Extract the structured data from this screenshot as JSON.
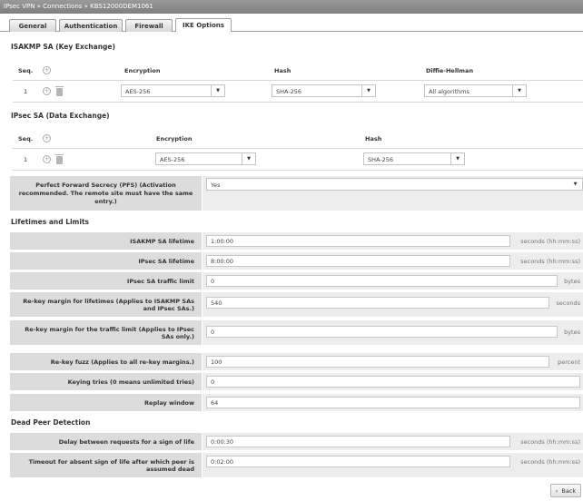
{
  "breadcrumb": "IPsec VPN » Connections » KBS12000DEM1061",
  "tabs": [
    {
      "label": "General"
    },
    {
      "label": "Authentication"
    },
    {
      "label": "Firewall"
    },
    {
      "label": "IKE Options"
    }
  ],
  "active_tab": "IKE Options",
  "isakmp": {
    "title": "ISAKMP SA (Key Exchange)",
    "headers": {
      "seq": "Seq.",
      "encryption": "Encryption",
      "hash": "Hash",
      "dh": "Diffie-Hellman"
    },
    "row": {
      "seq": "1",
      "encryption": "AES-256",
      "hash": "SHA-256",
      "dh": "All algorithms"
    }
  },
  "ipsec": {
    "title": "IPsec SA (Data Exchange)",
    "headers": {
      "seq": "Seq.",
      "encryption": "Encryption",
      "hash": "Hash"
    },
    "row": {
      "seq": "1",
      "encryption": "AES-256",
      "hash": "SHA-256"
    }
  },
  "pfs": {
    "label": "Perfect Forward Secrecy (PFS) (Activation recommended. The remote site must have the same entry.)",
    "value": "Yes"
  },
  "lifetimes": {
    "title": "Lifetimes and Limits",
    "rows": [
      {
        "label": "ISAKMP SA lifetime",
        "value": "1:00:00",
        "unit": "seconds (hh:mm:ss)"
      },
      {
        "label": "IPsec SA lifetime",
        "value": "8:00:00",
        "unit": "seconds (hh:mm:ss)"
      },
      {
        "label": "IPsec SA traffic limit",
        "value": "0",
        "unit": "bytes"
      },
      {
        "label": "Re-key margin for lifetimes (Applies to ISAKMP SAs and IPsec SAs.)",
        "value": "540",
        "unit": "seconds"
      },
      {
        "label": "Re-key margin for the traffic limit (Applies to IPsec SAs only.)",
        "value": "0",
        "unit": "bytes"
      },
      {
        "label": "Re-key fuzz (Applies to all re-key margins.)",
        "value": "100",
        "unit": "percent"
      },
      {
        "label": "Keying tries (0 means unlimited tries)",
        "value": "0",
        "unit": ""
      },
      {
        "label": "Replay window",
        "value": "64",
        "unit": ""
      }
    ]
  },
  "dpd": {
    "title": "Dead Peer Detection",
    "rows": [
      {
        "label": "Delay between requests for a sign of life",
        "value": "0:00:30",
        "unit": "seconds (hh:mm:ss)"
      },
      {
        "label": "Timeout for absent sign of life after which peer is assumed dead",
        "value": "0:02:00",
        "unit": "seconds (hh:mm:ss)"
      }
    ]
  },
  "back_button": {
    "icon": "‹",
    "label": "Back"
  }
}
